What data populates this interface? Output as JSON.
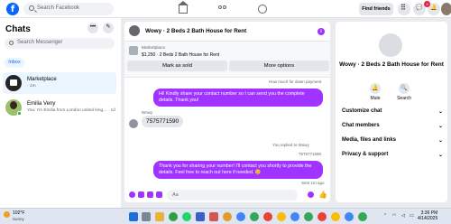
{
  "topbar": {
    "logo": "f",
    "search_placeholder": "Search Facebook",
    "find_friends": "Find friends",
    "notification_count": "9"
  },
  "left": {
    "title": "Chats",
    "more_label": "•••",
    "compose_label": "✎",
    "search_placeholder": "Search Messenger",
    "filter_inbox": "Inbox",
    "conversations": [
      {
        "name": "Marketplace",
        "sub": "· 1m"
      },
      {
        "name": "Emilia Veny",
        "sub": "You: I'm Emilia from London united king... · 1d"
      }
    ]
  },
  "center": {
    "header_title": "Wowy · 2 Beds 2 Bath House for Rent",
    "info_icon": "i",
    "listing_label": "Marketplace",
    "listing_price": "$1,250 · 2 Beds 2 Bath House for Rent",
    "mark_as_sold": "Mark as sold",
    "more_options": "More options",
    "messages": {
      "note_top": "How much for down payment",
      "out_1": "Hi! Kindly share your contact number so I can send you the complete details. Thank you!",
      "in_sender": "Wowy",
      "in_1": "7575771590",
      "reply_note": "You replied to Wowy",
      "reply_quote": "7575771590",
      "out_2": "Thank you for sharing your number! I'll contact you shortly to provide the details. Feel free to reach out here if needed. 😊",
      "sent_note": "Sent 1m ago"
    },
    "composer_placeholder": "Aa",
    "like_icon": "👍"
  },
  "right": {
    "name": "Wowy · 2 Beds 2 Bath House for Rent",
    "actions": [
      {
        "label": "Mute",
        "icon": "🔔"
      },
      {
        "label": "Search",
        "icon": "🔍"
      }
    ],
    "sections": [
      "Customize chat",
      "Chat members",
      "Media, files and links",
      "Privacy & support"
    ],
    "chevron": "⌄"
  },
  "taskbar": {
    "temp": "102°F",
    "condition": "Sunny",
    "time": "3:36 PM",
    "date": "4/14/2025"
  },
  "colors": {
    "accent": "#a033ff",
    "facebook_blue": "#0866ff"
  }
}
